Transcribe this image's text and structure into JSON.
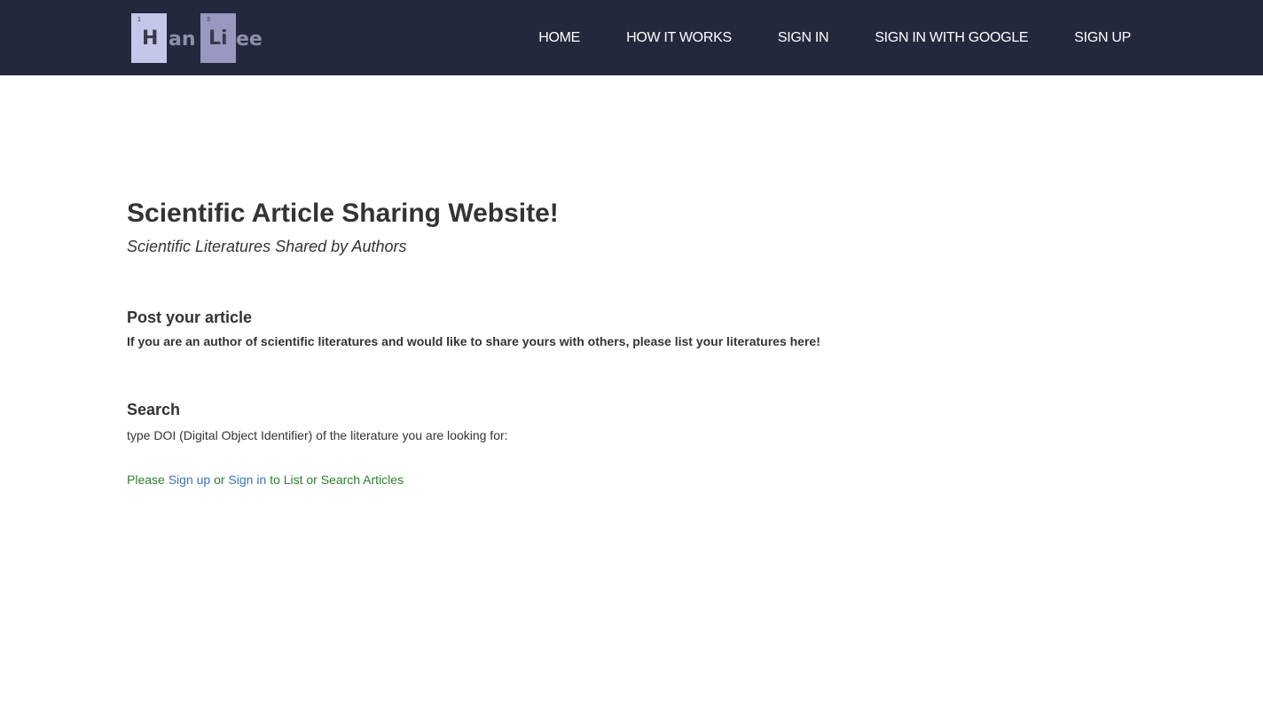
{
  "logo": {
    "tile1_number": "1",
    "tile1_letter": "H",
    "part1": "an",
    "tile2_number": "3",
    "tile2_letter": "Li",
    "part2": "ee"
  },
  "nav": {
    "items": [
      {
        "label": "HOME"
      },
      {
        "label": "HOW IT WORKS"
      },
      {
        "label": "SIGN IN"
      },
      {
        "label": "SIGN IN WITH GOOGLE"
      },
      {
        "label": "SIGN UP"
      }
    ]
  },
  "hero": {
    "title": "Scientific Article Sharing Website!",
    "subtitle": "Scientific Literatures Shared by Authors"
  },
  "post": {
    "title": "Post your article",
    "description": "If you are an author of scientific literatures and would like to share yours with others, please list your literatures here!"
  },
  "search": {
    "title": "Search",
    "description": "type DOI (Digital Object Identifier) of the literature you are looking for:"
  },
  "prompt": {
    "prefix": "Please ",
    "signup_link": "Sign up",
    "middle": " or ",
    "signin_link": "Sign in",
    "suffix": " to List or Search Articles"
  },
  "colors": {
    "navbar_bg": "#24283d",
    "prompt_text": "#2e7d32",
    "link": "#3a74b5"
  }
}
